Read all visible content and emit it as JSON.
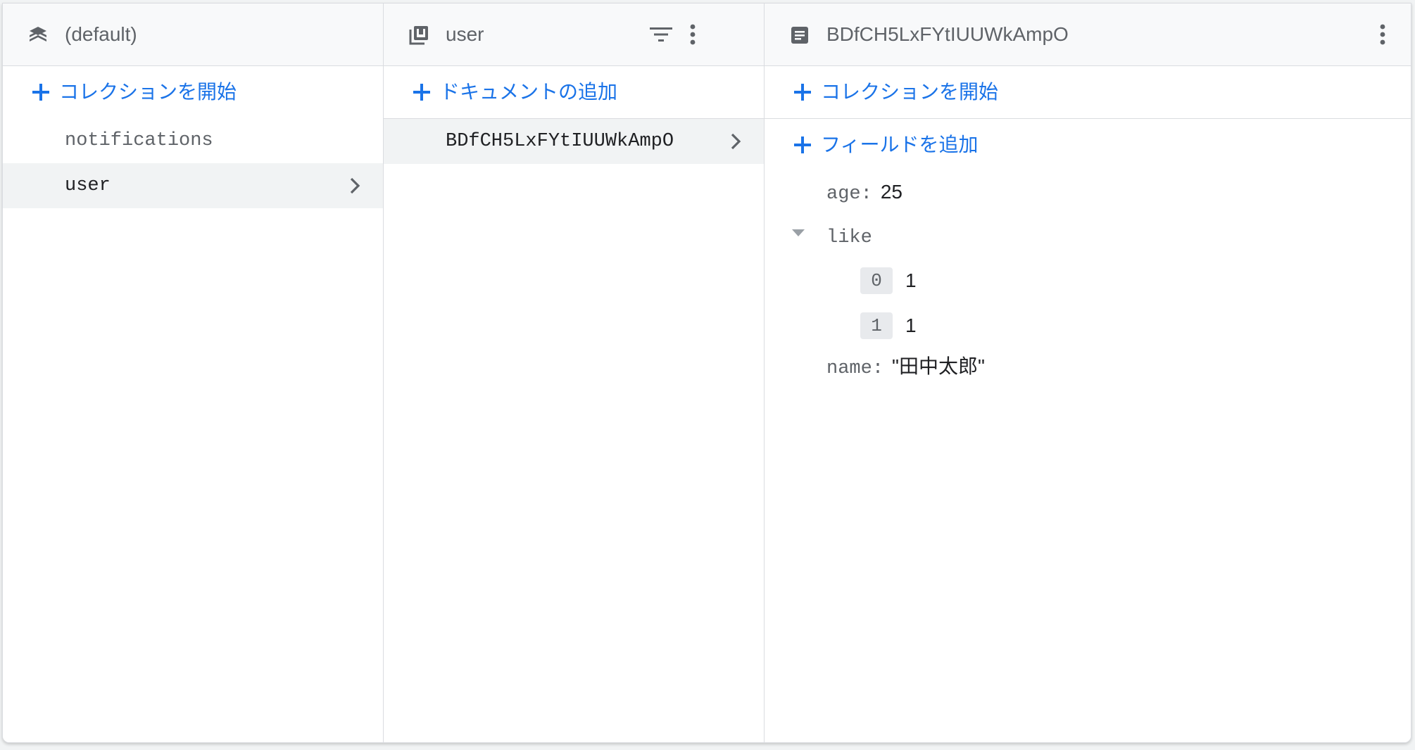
{
  "database_panel": {
    "title": "(default)",
    "add_label": "コレクションを開始",
    "collections": [
      {
        "name": "notifications",
        "selected": false
      },
      {
        "name": "user",
        "selected": true
      }
    ]
  },
  "collection_panel": {
    "title": "user",
    "add_label": "ドキュメントの追加",
    "documents": [
      {
        "id": "BDfCH5LxFYtIUUWkAmpO",
        "selected": true
      }
    ]
  },
  "document_panel": {
    "title": "BDfCH5LxFYtIUUWkAmpO",
    "add_collection_label": "コレクションを開始",
    "add_field_label": "フィールドを追加",
    "fields": {
      "age": {
        "key": "age",
        "sep": ":",
        "value": "25"
      },
      "like": {
        "key": "like",
        "items": [
          {
            "index": "0",
            "value": "1"
          },
          {
            "index": "1",
            "value": "1"
          }
        ]
      },
      "name": {
        "key": "name",
        "sep": ":",
        "value": "\"田中太郎\""
      }
    }
  },
  "colors": {
    "accent": "#1a73e8",
    "icon": "#5f6368",
    "border": "#dadce0",
    "header_bg": "#f8f9fa",
    "selected_bg": "#f1f3f4"
  }
}
